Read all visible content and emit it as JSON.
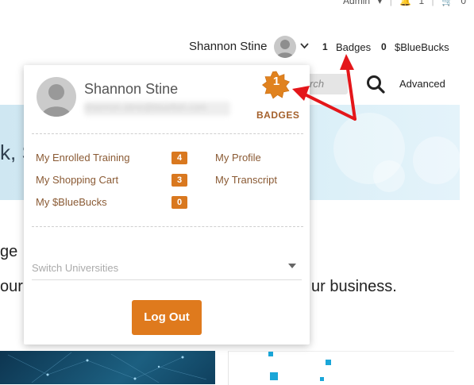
{
  "topbar": {
    "admin_label": "Admin",
    "notifications_count": "1",
    "cart_count": "0"
  },
  "header": {
    "user_name": "Shannon Stine",
    "badge_count": "1",
    "badges_label": "Badges",
    "bluebucks_count": "0",
    "bluebucks_label": "$BlueBucks",
    "search_placeholder": "rch",
    "advanced_label": "Advanced"
  },
  "hero": {
    "partial_text": "k, S"
  },
  "page_body": {
    "line1_partial": "ge",
    "line2_partial": "our",
    "line3_partial": "ur business."
  },
  "dropdown": {
    "user_name": "Shannon Stine",
    "email_obscured": "shannon.stine@bluefish.com",
    "badge_number": "1",
    "badges_label": "BADGES",
    "menu_left": [
      {
        "label": "My Enrolled Training",
        "count": "4"
      },
      {
        "label": "My Shopping Cart",
        "count": "3"
      },
      {
        "label": "My $BlueBucks",
        "count": "0"
      }
    ],
    "menu_right": [
      {
        "label": "My Profile"
      },
      {
        "label": "My Transcript"
      }
    ],
    "switch_universities_placeholder": "Switch Universities",
    "logout_label": "Log Out"
  },
  "colors": {
    "accent_orange": "#df7a1d",
    "link_brown": "#8a5a34",
    "annotation_red": "#e4161a",
    "badge_orange": "#e0821f"
  },
  "icons": [
    "chevron-down-icon",
    "search-icon",
    "badge-star-icon",
    "bell-icon",
    "cart-icon",
    "caret-down-icon"
  ]
}
